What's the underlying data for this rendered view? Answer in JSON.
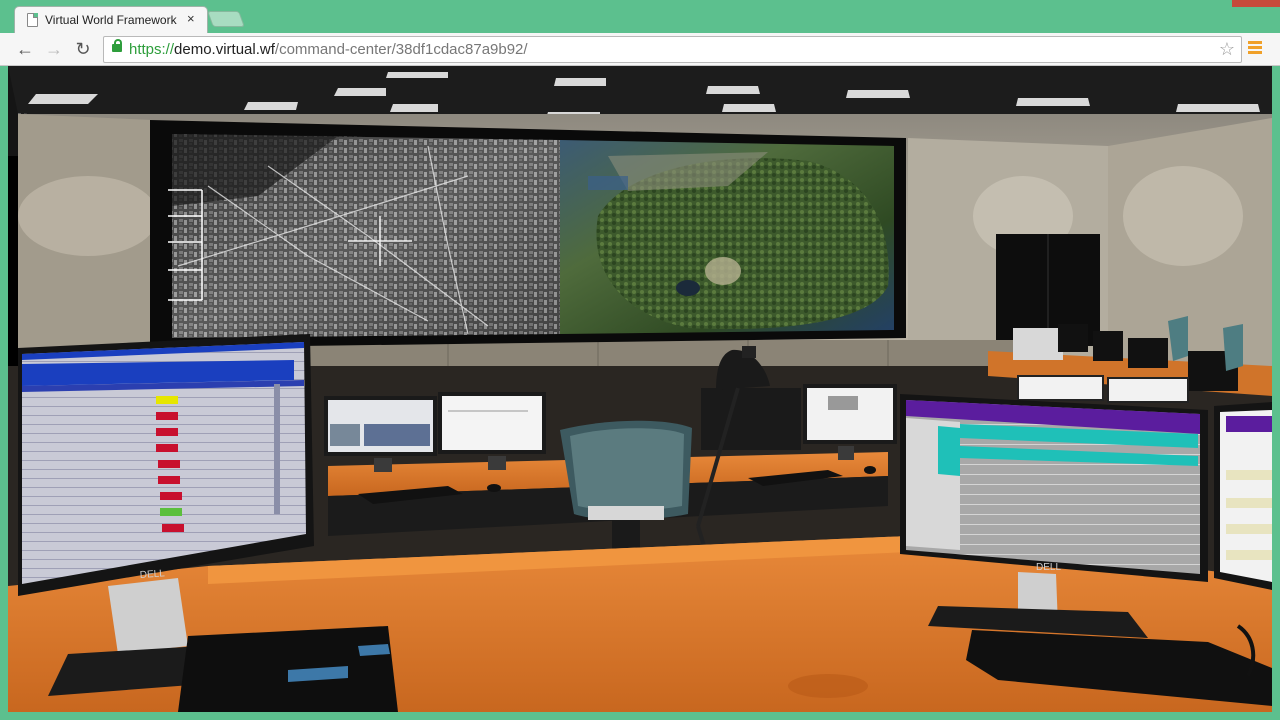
{
  "browser": {
    "tab_title": "Virtual World Framework",
    "tab_close": "×",
    "back_glyph": "←",
    "forward_glyph": "→",
    "reload_glyph": "↻",
    "url_scheme": "https://",
    "url_host": "demo.virtual.wf",
    "url_path": "/command-center/38df1cdac87a9b92/",
    "star_glyph": "☆"
  },
  "scene": {
    "description_icons": [
      "video-wall",
      "monitor",
      "desk",
      "office-chair",
      "desk-lamp"
    ],
    "monitor_brand": "DELL",
    "colors": {
      "desk": "#d9782c",
      "wall": "#b9b3a6",
      "ceiling": "#1a1a1a",
      "status_red": "#c8102e",
      "status_yellow": "#e6e600",
      "status_green": "#5cbf3c",
      "screen_blue": "#1a3fbf",
      "screen_purple": "#5b1d9e",
      "screen_teal": "#1fc0b8"
    }
  }
}
